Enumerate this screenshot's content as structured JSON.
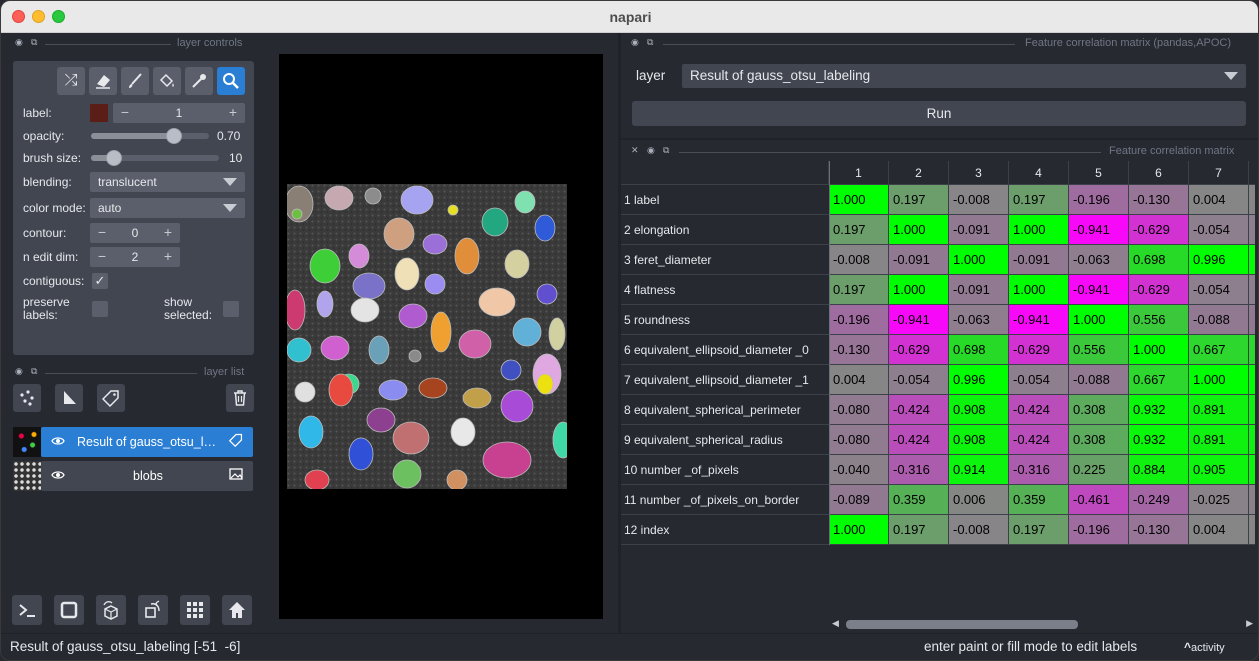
{
  "window": {
    "title": "napari"
  },
  "layer_controls": {
    "header": "layer controls",
    "tools": [
      "shuffle-icon",
      "eraser-icon",
      "brush-icon",
      "fill-bucket-icon",
      "picker-icon",
      "zoom-icon"
    ],
    "label": {
      "text": "label:",
      "value": "1",
      "swatch_color": "#5b1e16"
    },
    "opacity": {
      "text": "opacity:",
      "value": "0.70",
      "fraction": 0.7
    },
    "brush_size": {
      "text": "brush size:",
      "value": "10",
      "fraction": 0.18
    },
    "blending": {
      "text": "blending:",
      "value": "translucent"
    },
    "color_mode": {
      "text": "color mode:",
      "value": "auto"
    },
    "contour": {
      "text": "contour:",
      "value": "0"
    },
    "n_edit_dim": {
      "text": "n edit dim:",
      "value": "2"
    },
    "contiguous": {
      "text": "contiguous:",
      "check": "✓"
    },
    "preserve_labels": {
      "text1": "preserve",
      "text2": "labels:"
    },
    "show_selected": {
      "text1": "show",
      "text2": "selected:"
    },
    "minus": "−",
    "plus": "+"
  },
  "layer_list": {
    "header": "layer list",
    "layers": [
      {
        "name": "Result of gauss_otsu_labeling",
        "selected": true
      },
      {
        "name": "blobs",
        "selected": false
      }
    ]
  },
  "feature_panel": {
    "header": "Feature correlation matrix (pandas,APOC)",
    "layer_label": "layer",
    "layer_value": "Result of gauss_otsu_labeling",
    "run_label": "Run"
  },
  "matrix": {
    "header": "Feature correlation matrix",
    "columns": [
      "1",
      "2",
      "3",
      "4",
      "5",
      "6",
      "7"
    ],
    "rows": [
      "1 label",
      "2 elongation",
      "3 feret_diameter",
      "4 flatness",
      "5 roundness",
      "6 equivalent_ellipsoid_diameter _0",
      "7 equivalent_ellipsoid_diameter _1",
      "8 equivalent_spherical_perimeter",
      "9 equivalent_spherical_radius",
      "10 number _of_pixels",
      "11 number _of_pixels_on_border",
      "12 index"
    ],
    "values": [
      [
        "1.000",
        "0.197",
        "-0.008",
        "0.197",
        "-0.196",
        "-0.130",
        "0.004"
      ],
      [
        "0.197",
        "1.000",
        "-0.091",
        "1.000",
        "-0.941",
        "-0.629",
        "-0.054"
      ],
      [
        "-0.008",
        "-0.091",
        "1.000",
        "-0.091",
        "-0.063",
        "0.698",
        "0.996"
      ],
      [
        "0.197",
        "1.000",
        "-0.091",
        "1.000",
        "-0.941",
        "-0.629",
        "-0.054"
      ],
      [
        "-0.196",
        "-0.941",
        "-0.063",
        "-0.941",
        "1.000",
        "0.556",
        "-0.088"
      ],
      [
        "-0.130",
        "-0.629",
        "0.698",
        "-0.629",
        "0.556",
        "1.000",
        "0.667"
      ],
      [
        "0.004",
        "-0.054",
        "0.996",
        "-0.054",
        "-0.088",
        "0.667",
        "1.000"
      ],
      [
        "-0.080",
        "-0.424",
        "0.908",
        "-0.424",
        "0.308",
        "0.932",
        "0.891"
      ],
      [
        "-0.080",
        "-0.424",
        "0.908",
        "-0.424",
        "0.308",
        "0.932",
        "0.891"
      ],
      [
        "-0.040",
        "-0.316",
        "0.914",
        "-0.316",
        "0.225",
        "0.884",
        "0.905"
      ],
      [
        "-0.089",
        "0.359",
        "0.006",
        "0.359",
        "-0.461",
        "-0.249",
        "-0.025"
      ],
      [
        "1.000",
        "0.197",
        "-0.008",
        "0.197",
        "-0.196",
        "-0.130",
        "0.004"
      ]
    ]
  },
  "status": {
    "left": "Result of gauss_otsu_labeling [-51  -6]",
    "right": "enter paint or fill mode to edit labels",
    "activity": "activity"
  },
  "colors": {
    "accent": "#2a7ed4",
    "panel": "#414651",
    "bg": "#262930"
  }
}
